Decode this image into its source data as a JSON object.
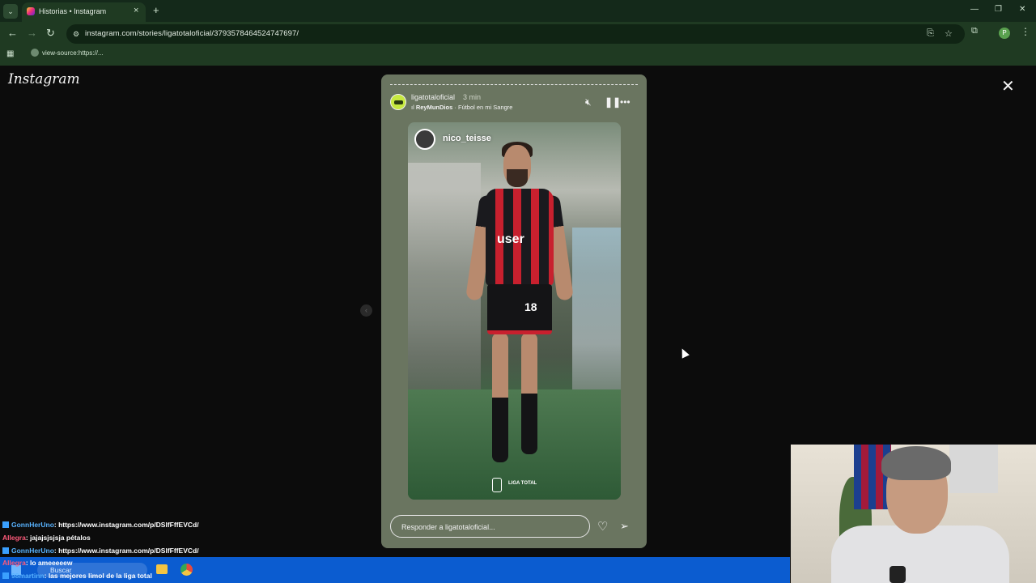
{
  "browser": {
    "tab_title": "Historias • Instagram",
    "url": "instagram.com/stories/ligatotaloficial/3793578464524747697/",
    "bookmark": "view-source:https://..."
  },
  "instagram": {
    "logo": "Instagram",
    "story": {
      "username": "ligatotaloficial",
      "time": "3 min",
      "music_artist": "ReyMunDios",
      "music_sep": " · ",
      "music_title": "Fútbol en mi Sangre",
      "sticker_name": "nico_teisse",
      "league_label": "LIGA TOTAL",
      "jersey_text": "user",
      "jersey_number": "18",
      "reply_placeholder": "Responder a ligatotaloficial..."
    }
  },
  "chat": [
    {
      "user": "GonnHerUno",
      "message": ": https://www.instagram.com/p/DSlfFffEVCd/",
      "color": "blue",
      "icon": true
    },
    {
      "user": "Allegra",
      "message": ": jajajsjsjsja pétalos",
      "color": "red",
      "icon": false
    },
    {
      "user": "GonnHerUno",
      "message": ": https://www.instagram.com/p/DSlfFffEVCd/",
      "color": "blue",
      "icon": true
    },
    {
      "user": "Allegra",
      "message": ": lo ameeeeew",
      "color": "red",
      "icon": false
    },
    {
      "user": "98martinn",
      "message": ": las mejores limol de la liga total",
      "color": "blue",
      "icon": true
    }
  ],
  "taskbar": {
    "search_label": "Buscar"
  }
}
